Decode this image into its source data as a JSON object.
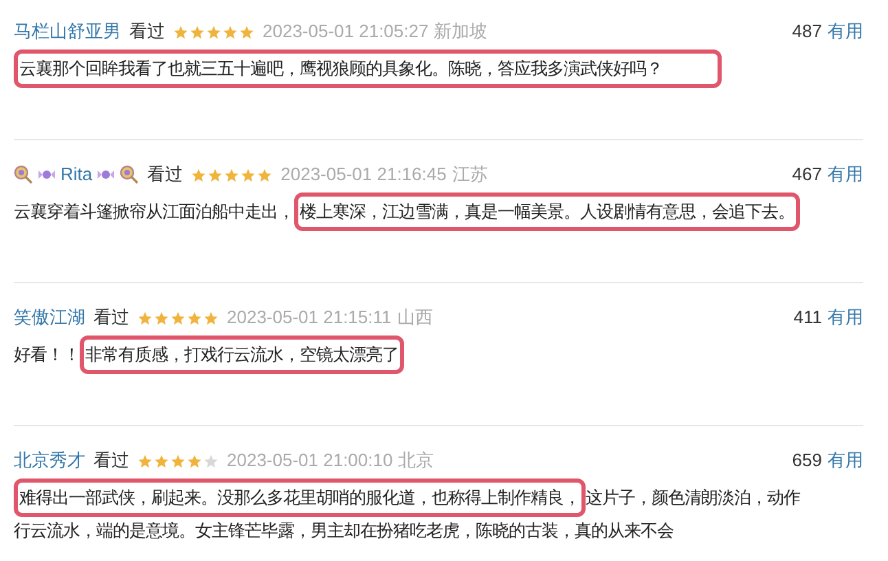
{
  "comments": [
    {
      "user": "马栏山舒亚男",
      "name_icons": false,
      "status": "看过",
      "stars": 5,
      "time": "2023-05-01 21:05:27",
      "location": "新加坡",
      "votes": "487",
      "vote_label": "有用",
      "segments": [
        {
          "text": "云襄那个回眸我看了也就三五十遍吧，鹰视狼顾的具象化。陈晓，答应我多演武侠好吗？",
          "highlighted": true,
          "wide": true
        }
      ]
    },
    {
      "user": "Rita",
      "name_icons": true,
      "status": "看过",
      "stars": 5,
      "time": "2023-05-01 21:16:45",
      "location": "江苏",
      "votes": "467",
      "vote_label": "有用",
      "segments": [
        {
          "text": "云襄穿着斗篷掀帘从江面泊船中走出，",
          "highlighted": false
        },
        {
          "text": "楼上寒深，江边雪满，真是一幅美景。人设剧情有意思，会追下去。",
          "highlighted": true
        }
      ]
    },
    {
      "user": "笑傲江湖",
      "name_icons": false,
      "status": "看过",
      "stars": 5,
      "time": "2023-05-01 21:15:11",
      "location": "山西",
      "votes": "411",
      "vote_label": "有用",
      "segments": [
        {
          "text": "好看！！",
          "highlighted": false
        },
        {
          "text": "非常有质感，打戏行云流水，空镜太漂亮了",
          "highlighted": true
        }
      ]
    },
    {
      "user": "北京秀才",
      "name_icons": false,
      "status": "看过",
      "stars": 4,
      "time": "2023-05-01 21:00:10",
      "location": "北京",
      "votes": "659",
      "vote_label": "有用",
      "segments": [
        {
          "text": "难得出一部武侠，刷起来。没那么多花里胡哨的服化道，也称得上制作精良，",
          "highlighted": true
        },
        {
          "text": "这片子，颜色清朗淡泊，动作",
          "highlighted": false
        },
        {
          "text": "行云流水，端的是意境。女主锋芒毕露，男主却在扮猪吃老虎，陈晓的古装，真的从来不会",
          "highlighted": false
        }
      ]
    }
  ]
}
